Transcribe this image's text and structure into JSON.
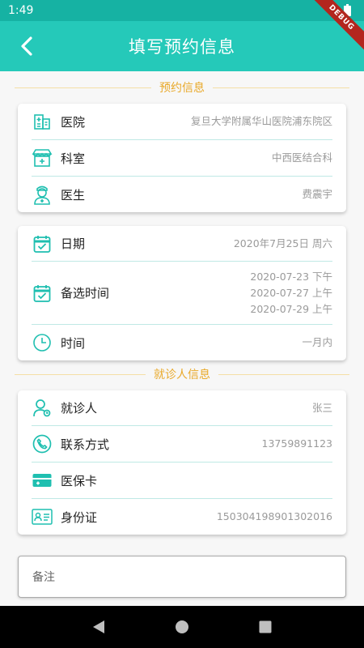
{
  "status_bar": {
    "time": "1:49",
    "debug_label": "DEBUG"
  },
  "app_bar": {
    "title": "填写预约信息",
    "back_icon": "chevron-left-icon"
  },
  "colors": {
    "primary": "#25c9b9",
    "status": "#16b2a3",
    "section": "#e9a92a",
    "icon": "#1fbfb0"
  },
  "appointment": {
    "section_title": "预约信息",
    "hospital": {
      "label": "医院",
      "value": "复旦大学附属华山医院浦东院区",
      "icon": "hospital-icon"
    },
    "department": {
      "label": "科室",
      "value": "中西医结合科",
      "icon": "clinic-icon"
    },
    "doctor": {
      "label": "医生",
      "value": "费震宇",
      "icon": "doctor-icon"
    }
  },
  "schedule": {
    "date": {
      "label": "日期",
      "value": "2020年7月25日  周六",
      "icon": "calendar-icon"
    },
    "alternate": {
      "label": "备选时间",
      "icon": "calendar-check-icon",
      "values": [
        "2020-07-23 下午",
        "2020-07-27 上午",
        "2020-07-29 上午"
      ]
    },
    "time": {
      "label": "时间",
      "value": "一月内",
      "icon": "clock-icon"
    }
  },
  "patient": {
    "section_title": "就诊人信息",
    "person": {
      "label": "就诊人",
      "value": "张三",
      "icon": "person-icon"
    },
    "contact": {
      "label": "联系方式",
      "value": "13759891123",
      "icon": "phone-icon"
    },
    "insurance": {
      "label": "医保卡",
      "value": "",
      "icon": "card-icon"
    },
    "id_card": {
      "label": "身份证",
      "value": "150304198901302016",
      "icon": "id-card-icon"
    }
  },
  "notes": {
    "placeholder": "备注"
  }
}
